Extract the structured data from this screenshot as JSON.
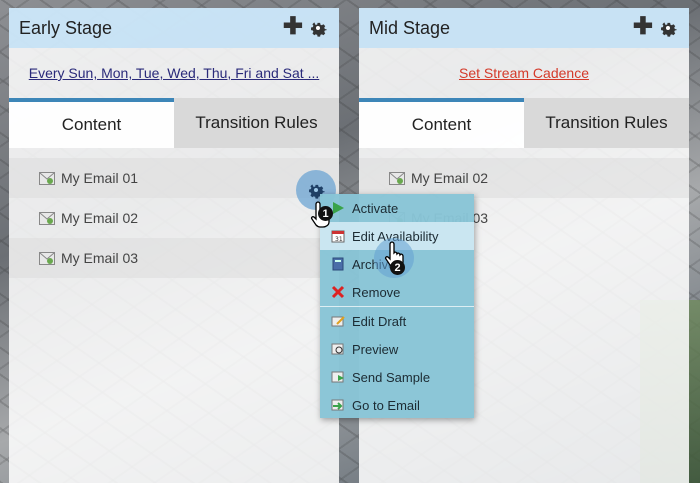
{
  "early_stage": {
    "title": "Early Stage",
    "cadence_text": "Every Sun, Mon, Tue, Wed, Thu, Fri and Sat ...",
    "tabs": [
      {
        "label": "Content"
      },
      {
        "label": "Transition Rules"
      }
    ],
    "emails": [
      {
        "name": "My Email 01"
      },
      {
        "name": "My Email 02"
      },
      {
        "name": "My Email 03"
      }
    ]
  },
  "mid_stage": {
    "title": "Mid Stage",
    "cadence_text": "Set Stream Cadence",
    "tabs": [
      {
        "label": "Content"
      },
      {
        "label": "Transition Rules"
      }
    ],
    "emails": [
      {
        "name": "My Email 02"
      },
      {
        "name": "My Email 03"
      }
    ]
  },
  "context_menu": {
    "items": [
      {
        "label": "Activate",
        "icon": "play-icon"
      },
      {
        "label": "Edit Availability",
        "icon": "calendar-icon"
      },
      {
        "label": "Archive",
        "icon": "archive-icon"
      },
      {
        "label": "Remove",
        "icon": "remove-icon"
      },
      {
        "label": "Edit Draft",
        "icon": "edit-draft-icon"
      },
      {
        "label": "Preview",
        "icon": "preview-icon"
      },
      {
        "label": "Send Sample",
        "icon": "send-sample-icon"
      },
      {
        "label": "Go to Email",
        "icon": "go-to-email-icon"
      }
    ]
  },
  "annotations": {
    "step_1": "1",
    "step_2": "2"
  },
  "colors": {
    "header_bg": "#c6e2f4",
    "tab_accent": "#3d86b8",
    "menu_bg": "#88c4d6",
    "cadence_link": "#d43a2a"
  }
}
